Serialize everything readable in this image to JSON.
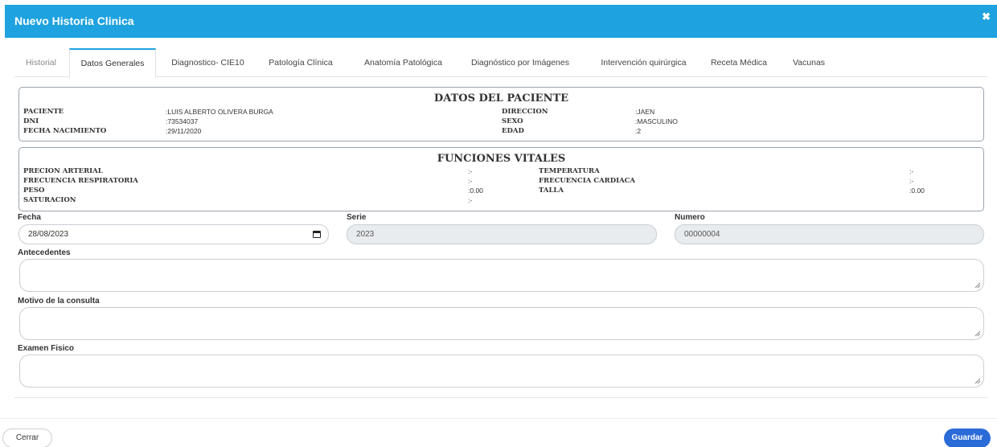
{
  "modal": {
    "title": "Nuevo Historia Clinica",
    "close_symbol": "✖"
  },
  "tabs": [
    {
      "label": "Historial"
    },
    {
      "label": "Datos Generales"
    },
    {
      "label": "Diagnostico- CIE10"
    },
    {
      "label": "Patología Clínica"
    },
    {
      "label": "Anatomía Patológica"
    },
    {
      "label": "Diagnóstico por Imágenes"
    },
    {
      "label": "Intervención quirúrgica"
    },
    {
      "label": "Receta Médica"
    },
    {
      "label": "Vacunas"
    }
  ],
  "active_tab": "Datos Generales",
  "patient": {
    "title": "DATOS DEL PACIENTE",
    "paciente_label": "PACIENTE",
    "paciente_value": ":LUIS ALBERTO OLIVERA BURGA",
    "dni_label": "DNI",
    "dni_value": ":73534037",
    "fnac_label": "FECHA NACIMIENTO",
    "fnac_value": ":29/11/2020",
    "direccion_label": "DIRECCION",
    "direccion_value": ":JAEN",
    "sexo_label": "SEXO",
    "sexo_value": ":MASCULINO",
    "edad_label": "EDAD",
    "edad_value": ":2"
  },
  "vitals": {
    "title": "FUNCIONES VITALES",
    "pa_label": "PRECION ARTERIAL",
    "pa_value": ":-",
    "fr_label": "FRECUENCIA RESPIRATORIA",
    "fr_value": ":-",
    "peso_label": "PESO",
    "peso_value": ":0.00",
    "sat_label": "SATURACION",
    "sat_value": ":-",
    "temp_label": "TEMPERATURA",
    "temp_value": ":-",
    "fc_label": "FRECUENCIA CARDIACA",
    "fc_value": ":-",
    "talla_label": "TALLA",
    "talla_value": ":0.00"
  },
  "form": {
    "fecha_label": "Fecha",
    "fecha_value": "28/08/2023",
    "serie_label": "Serie",
    "serie_value": "2023",
    "numero_label": "Numero",
    "numero_value": "00000004",
    "antecedentes_label": "Antecedentes",
    "motivo_label": "Motivo de la consulta",
    "examen_label": "Examen Fisico"
  },
  "footer": {
    "cerrar_label": "Cerrar",
    "guardar_label": "Guardar"
  },
  "colors": {
    "header": "#1ea2e0",
    "primary_button": "#2b6bd8"
  }
}
